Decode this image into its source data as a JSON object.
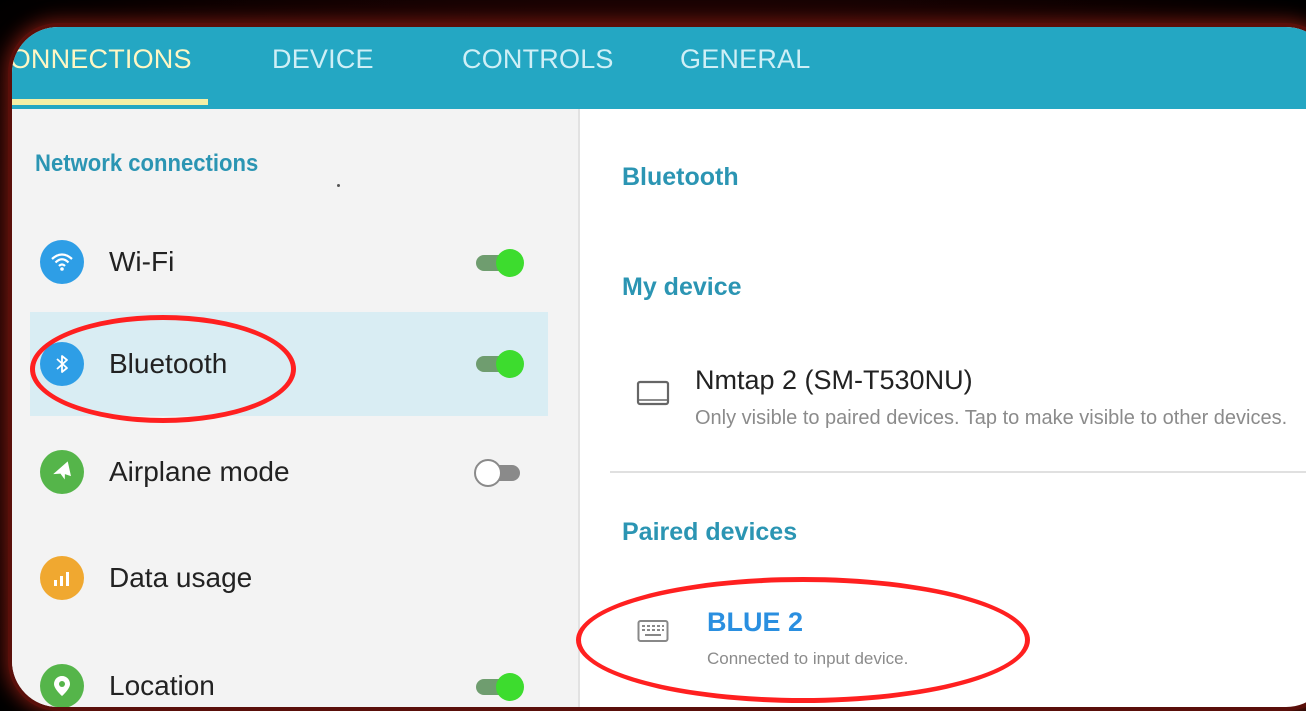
{
  "tabs": [
    "CONNECTIONS",
    "DEVICE",
    "CONTROLS",
    "GENERAL"
  ],
  "active_tab": "CONNECTIONS",
  "sidebar": {
    "section_title": "Network connections",
    "items": [
      {
        "label": "Wi-Fi",
        "icon": "wifi-icon",
        "color": "#2e9ee6",
        "toggle": "on"
      },
      {
        "label": "Bluetooth",
        "icon": "bluetooth-icon",
        "color": "#2e9ee6",
        "toggle": "on",
        "selected": true
      },
      {
        "label": "Airplane mode",
        "icon": "airplane-icon",
        "color": "#55b54a",
        "toggle": "off"
      },
      {
        "label": "Data usage",
        "icon": "data-usage-icon",
        "color": "#f0a830"
      },
      {
        "label": "Location",
        "icon": "location-icon",
        "color": "#55b54a",
        "toggle": "on"
      }
    ]
  },
  "detail": {
    "title": "Bluetooth",
    "my_device": {
      "section": "My device",
      "name": "Nmtap 2 (SM-T530NU)",
      "status": "Only visible to paired devices. Tap to make visible to other devices."
    },
    "paired": {
      "section": "Paired devices",
      "name": "BLUE 2",
      "status": "Connected to input device."
    }
  },
  "colors": {
    "tab_bar": "#24a7c3",
    "accent": "#2b95b3",
    "annotation": "#ff2020"
  }
}
